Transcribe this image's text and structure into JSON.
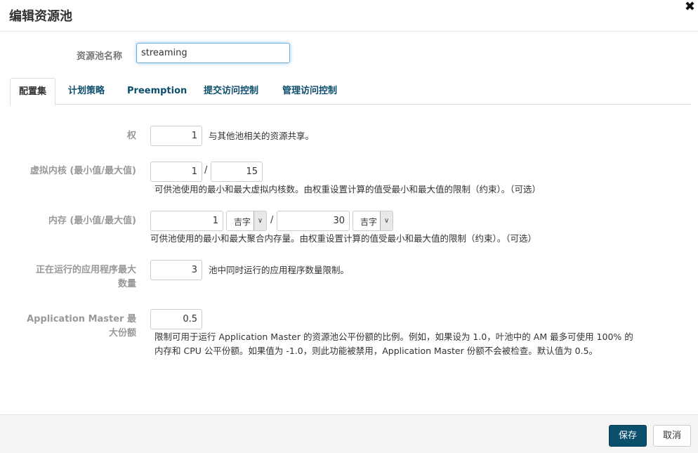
{
  "dialog": {
    "title": "编辑资源池",
    "close_glyph": "✖"
  },
  "pool_name": {
    "label": "资源池名称",
    "value": "streaming"
  },
  "tabs": [
    {
      "label": "配置集",
      "active": true
    },
    {
      "label": "计划策略",
      "active": false
    },
    {
      "label": "Preemption",
      "active": false
    },
    {
      "label": "提交访问控制",
      "active": false
    },
    {
      "label": "管理访问控制",
      "active": false
    }
  ],
  "form": {
    "weight": {
      "label": "权",
      "value": "1",
      "help": "与其他池相关的资源共享。"
    },
    "vcores": {
      "label": "虚拟内核 (最小值/最大值)",
      "min": "1",
      "max": "15",
      "separator": "/",
      "help": "可供池使用的最小和最大虚拟内核数。由权重设置计算的值受最小和最大值的限制（约束）。（可选）"
    },
    "memory": {
      "label": "内存 (最小值/最大值)",
      "min": "1",
      "min_unit": "吉字",
      "max": "30",
      "max_unit": "吉字",
      "separator": "/",
      "help": "可供池使用的最小和最大聚合内存量。由权重设置计算的值受最小和最大值的限制（约束）。（可选）"
    },
    "max_apps": {
      "label_line1": "正在运行的应用程序最大",
      "label_line2": "数量",
      "value": "3",
      "help": "池中同时运行的应用程序数量限制。"
    },
    "am_share": {
      "label_line1": "Application Master 最",
      "label_line2": "大份额",
      "value": "0.5",
      "help_line1": "限制可用于运行 Application Master 的资源池公平份额的比例。例如，如果设为 1.0，叶池中的 AM 最多可使用 100% 的",
      "help_line2": "内存和 CPU 公平份额。如果值为 -1.0，则此功能被禁用，Application Master 份额不会被检查。默认值为 0.5。"
    }
  },
  "footer": {
    "save_label": "保存",
    "cancel_label": "取消"
  },
  "colors": {
    "primary": "#0b4f6c",
    "tab_link": "#0b4f6c",
    "label_gray": "#999999",
    "focus_border": "#66afe9"
  },
  "icons": {
    "close": "close-icon",
    "dropdown": "chevron-down-icon"
  }
}
